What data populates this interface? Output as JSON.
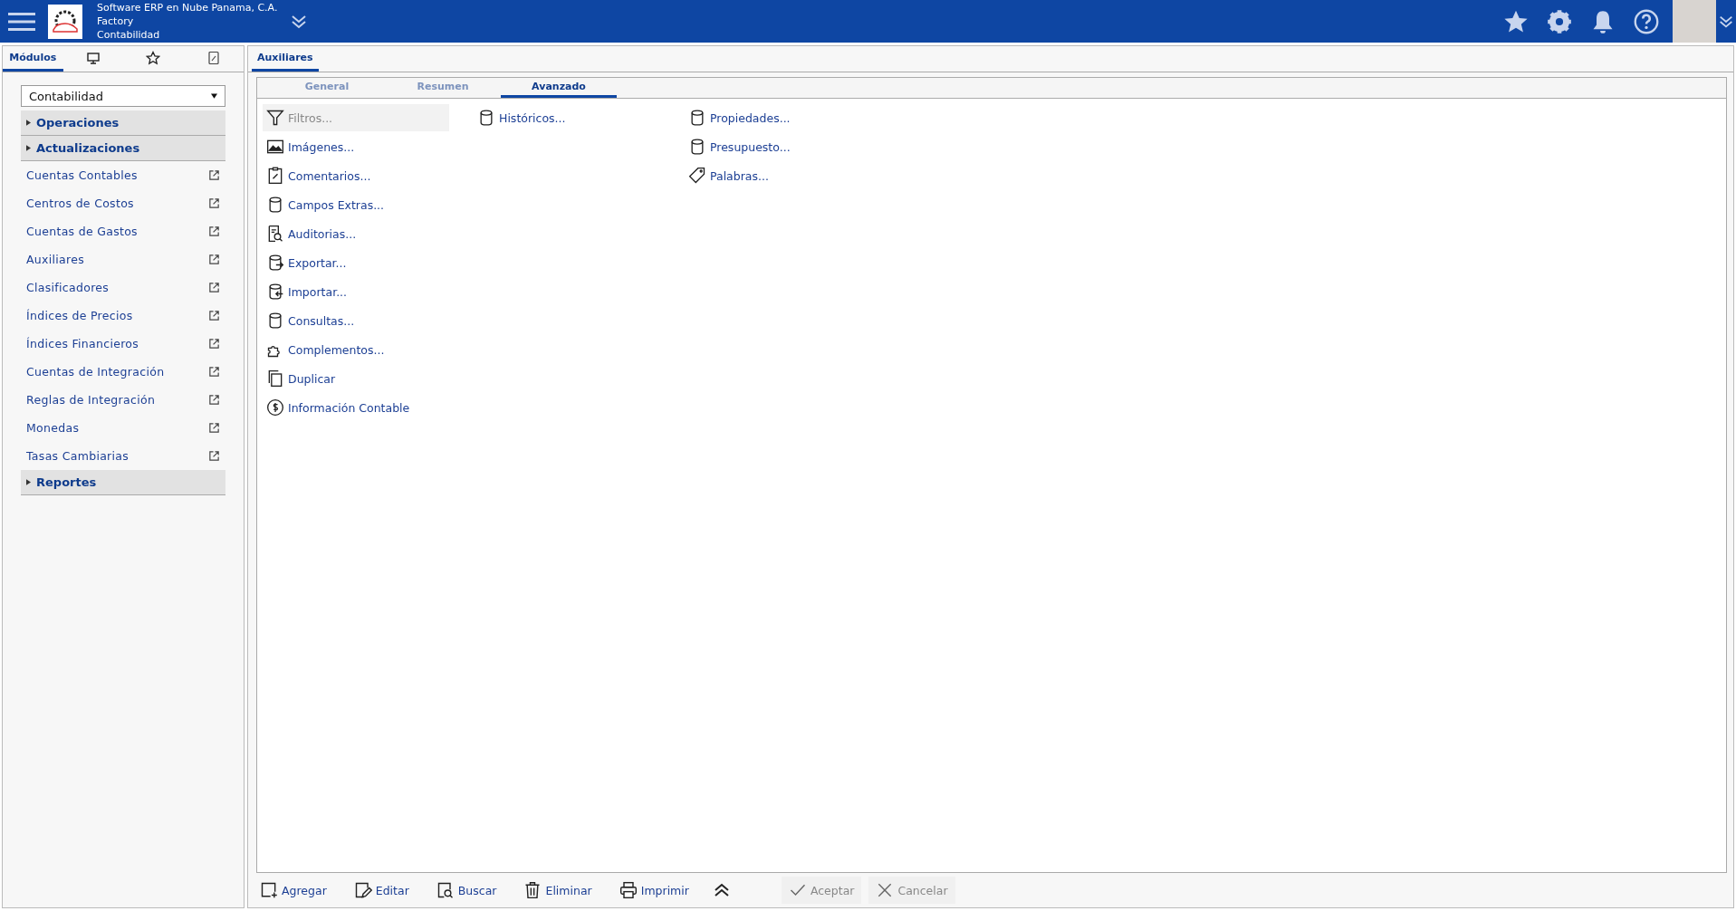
{
  "header": {
    "company": "Software ERP en Nube Panama, C.A.",
    "site": "Factory",
    "module": "Contabilidad"
  },
  "sidebar": {
    "tabs": [
      {
        "label": "Módulos",
        "selected": true
      },
      {
        "selected": false
      },
      {
        "selected": false
      },
      {
        "selected": false
      }
    ],
    "module_select": {
      "value": "Contabilidad"
    },
    "sections": [
      {
        "label": "Operaciones"
      },
      {
        "label": "Actualizaciones",
        "children": [
          {
            "label": "Cuentas Contables"
          },
          {
            "label": "Centros de Costos"
          },
          {
            "label": "Cuentas de Gastos"
          },
          {
            "label": "Auxiliares"
          },
          {
            "label": "Clasificadores"
          },
          {
            "label": "Índices de Precios"
          },
          {
            "label": "Índices Financieros"
          },
          {
            "label": "Cuentas de Integración"
          },
          {
            "label": "Reglas de Integración"
          },
          {
            "label": "Monedas"
          },
          {
            "label": "Tasas Cambiarias"
          }
        ]
      },
      {
        "label": "Reportes"
      }
    ]
  },
  "main": {
    "tab": {
      "label": "Auxiliares",
      "selected": true
    },
    "subtabs": [
      {
        "label": "General",
        "selected": false
      },
      {
        "label": "Resumen",
        "selected": false
      },
      {
        "label": "Avanzado",
        "selected": true
      }
    ],
    "columns": [
      [
        {
          "label": "Filtros...",
          "disabled": true
        },
        {
          "label": "Imágenes...",
          "disabled": false
        },
        {
          "label": "Comentarios...",
          "disabled": false
        },
        {
          "label": "Campos Extras...",
          "disabled": false
        },
        {
          "label": "Auditorias...",
          "disabled": false
        },
        {
          "label": "Exportar...",
          "disabled": false
        },
        {
          "label": "Importar...",
          "disabled": false
        },
        {
          "label": "Consultas...",
          "disabled": false
        },
        {
          "label": "Complementos...",
          "disabled": false
        },
        {
          "label": "Duplicar",
          "disabled": false
        },
        {
          "label": "Información Contable",
          "disabled": false
        }
      ],
      [
        {
          "label": "Históricos...",
          "disabled": false
        }
      ],
      [
        {
          "label": "Propiedades...",
          "disabled": false
        },
        {
          "label": "Presupuesto...",
          "disabled": false
        },
        {
          "label": "Palabras...",
          "disabled": false
        }
      ]
    ]
  },
  "toolbar": [
    {
      "label": "Agregar",
      "disabled": false
    },
    {
      "label": "Editar",
      "disabled": false
    },
    {
      "label": "Buscar",
      "disabled": false
    },
    {
      "label": "Eliminar",
      "disabled": false
    },
    {
      "label": "Imprimir",
      "disabled": false
    },
    {
      "label": "Aceptar",
      "disabled": true
    },
    {
      "label": "Cancelar",
      "disabled": true
    }
  ]
}
